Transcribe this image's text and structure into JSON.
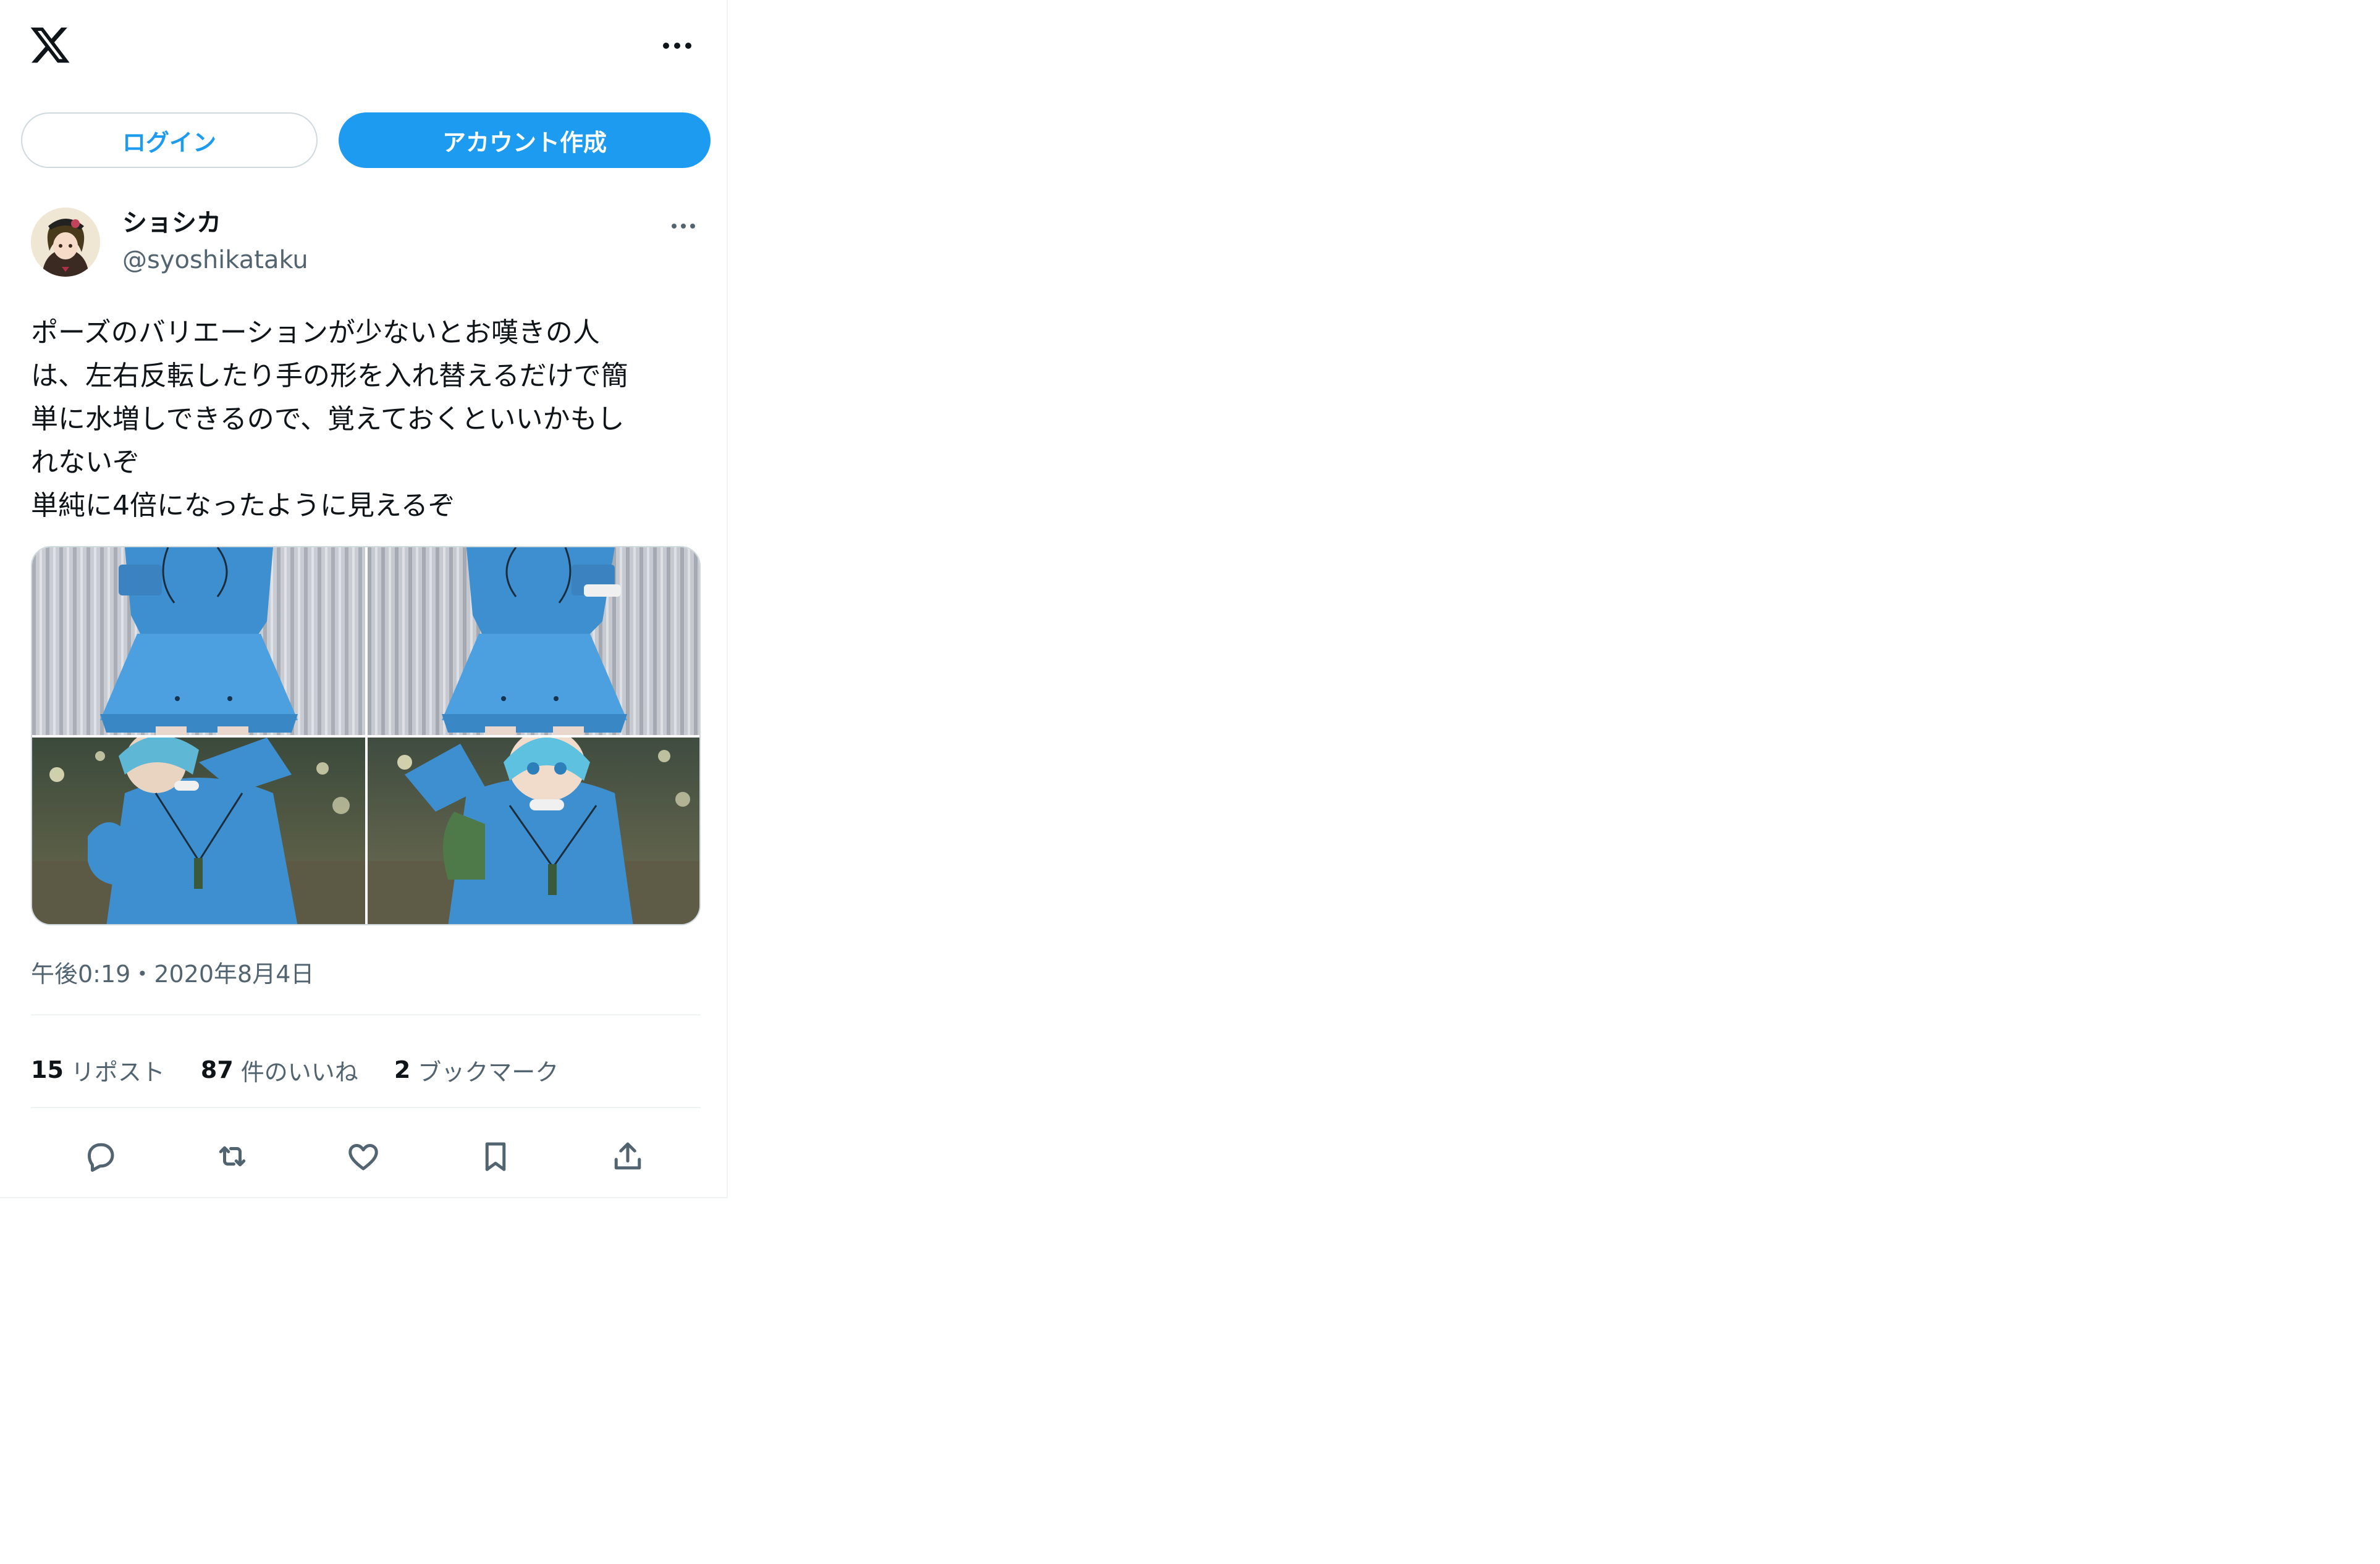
{
  "header": {
    "logo_icon": "x-logo-icon",
    "more_icon": "more-horizontal-icon"
  },
  "auth": {
    "login_label": "ログイン",
    "signup_label": "アカウント作成"
  },
  "tweet": {
    "author": {
      "display_name": "ショシカ",
      "handle": "@syoshikataku"
    },
    "text_lines": [
      "ポーズのバリエーションが少ないとお嘆きの人",
      "は、左右反転したり手の形を入れ替えるだけで簡",
      "単に水増しできるので、覚えておくといいかもし",
      "れないぞ",
      "単純に4倍になったように見えるぞ"
    ],
    "timestamp": "午後0:19・2020年8月4日",
    "stats": {
      "reposts_count": "15",
      "reposts_label": "リポスト",
      "likes_count": "87",
      "likes_label": "件のいいね",
      "bookmarks_count": "2",
      "bookmarks_label": "ブックマーク"
    },
    "actions": [
      "reply-icon",
      "repost-icon",
      "like-icon",
      "bookmark-icon",
      "share-icon"
    ]
  },
  "colors": {
    "accent": "#1d9bf0",
    "text_primary": "#0f1419",
    "text_secondary": "#536471",
    "border": "#cfd9de",
    "divider": "#eff3f4"
  }
}
